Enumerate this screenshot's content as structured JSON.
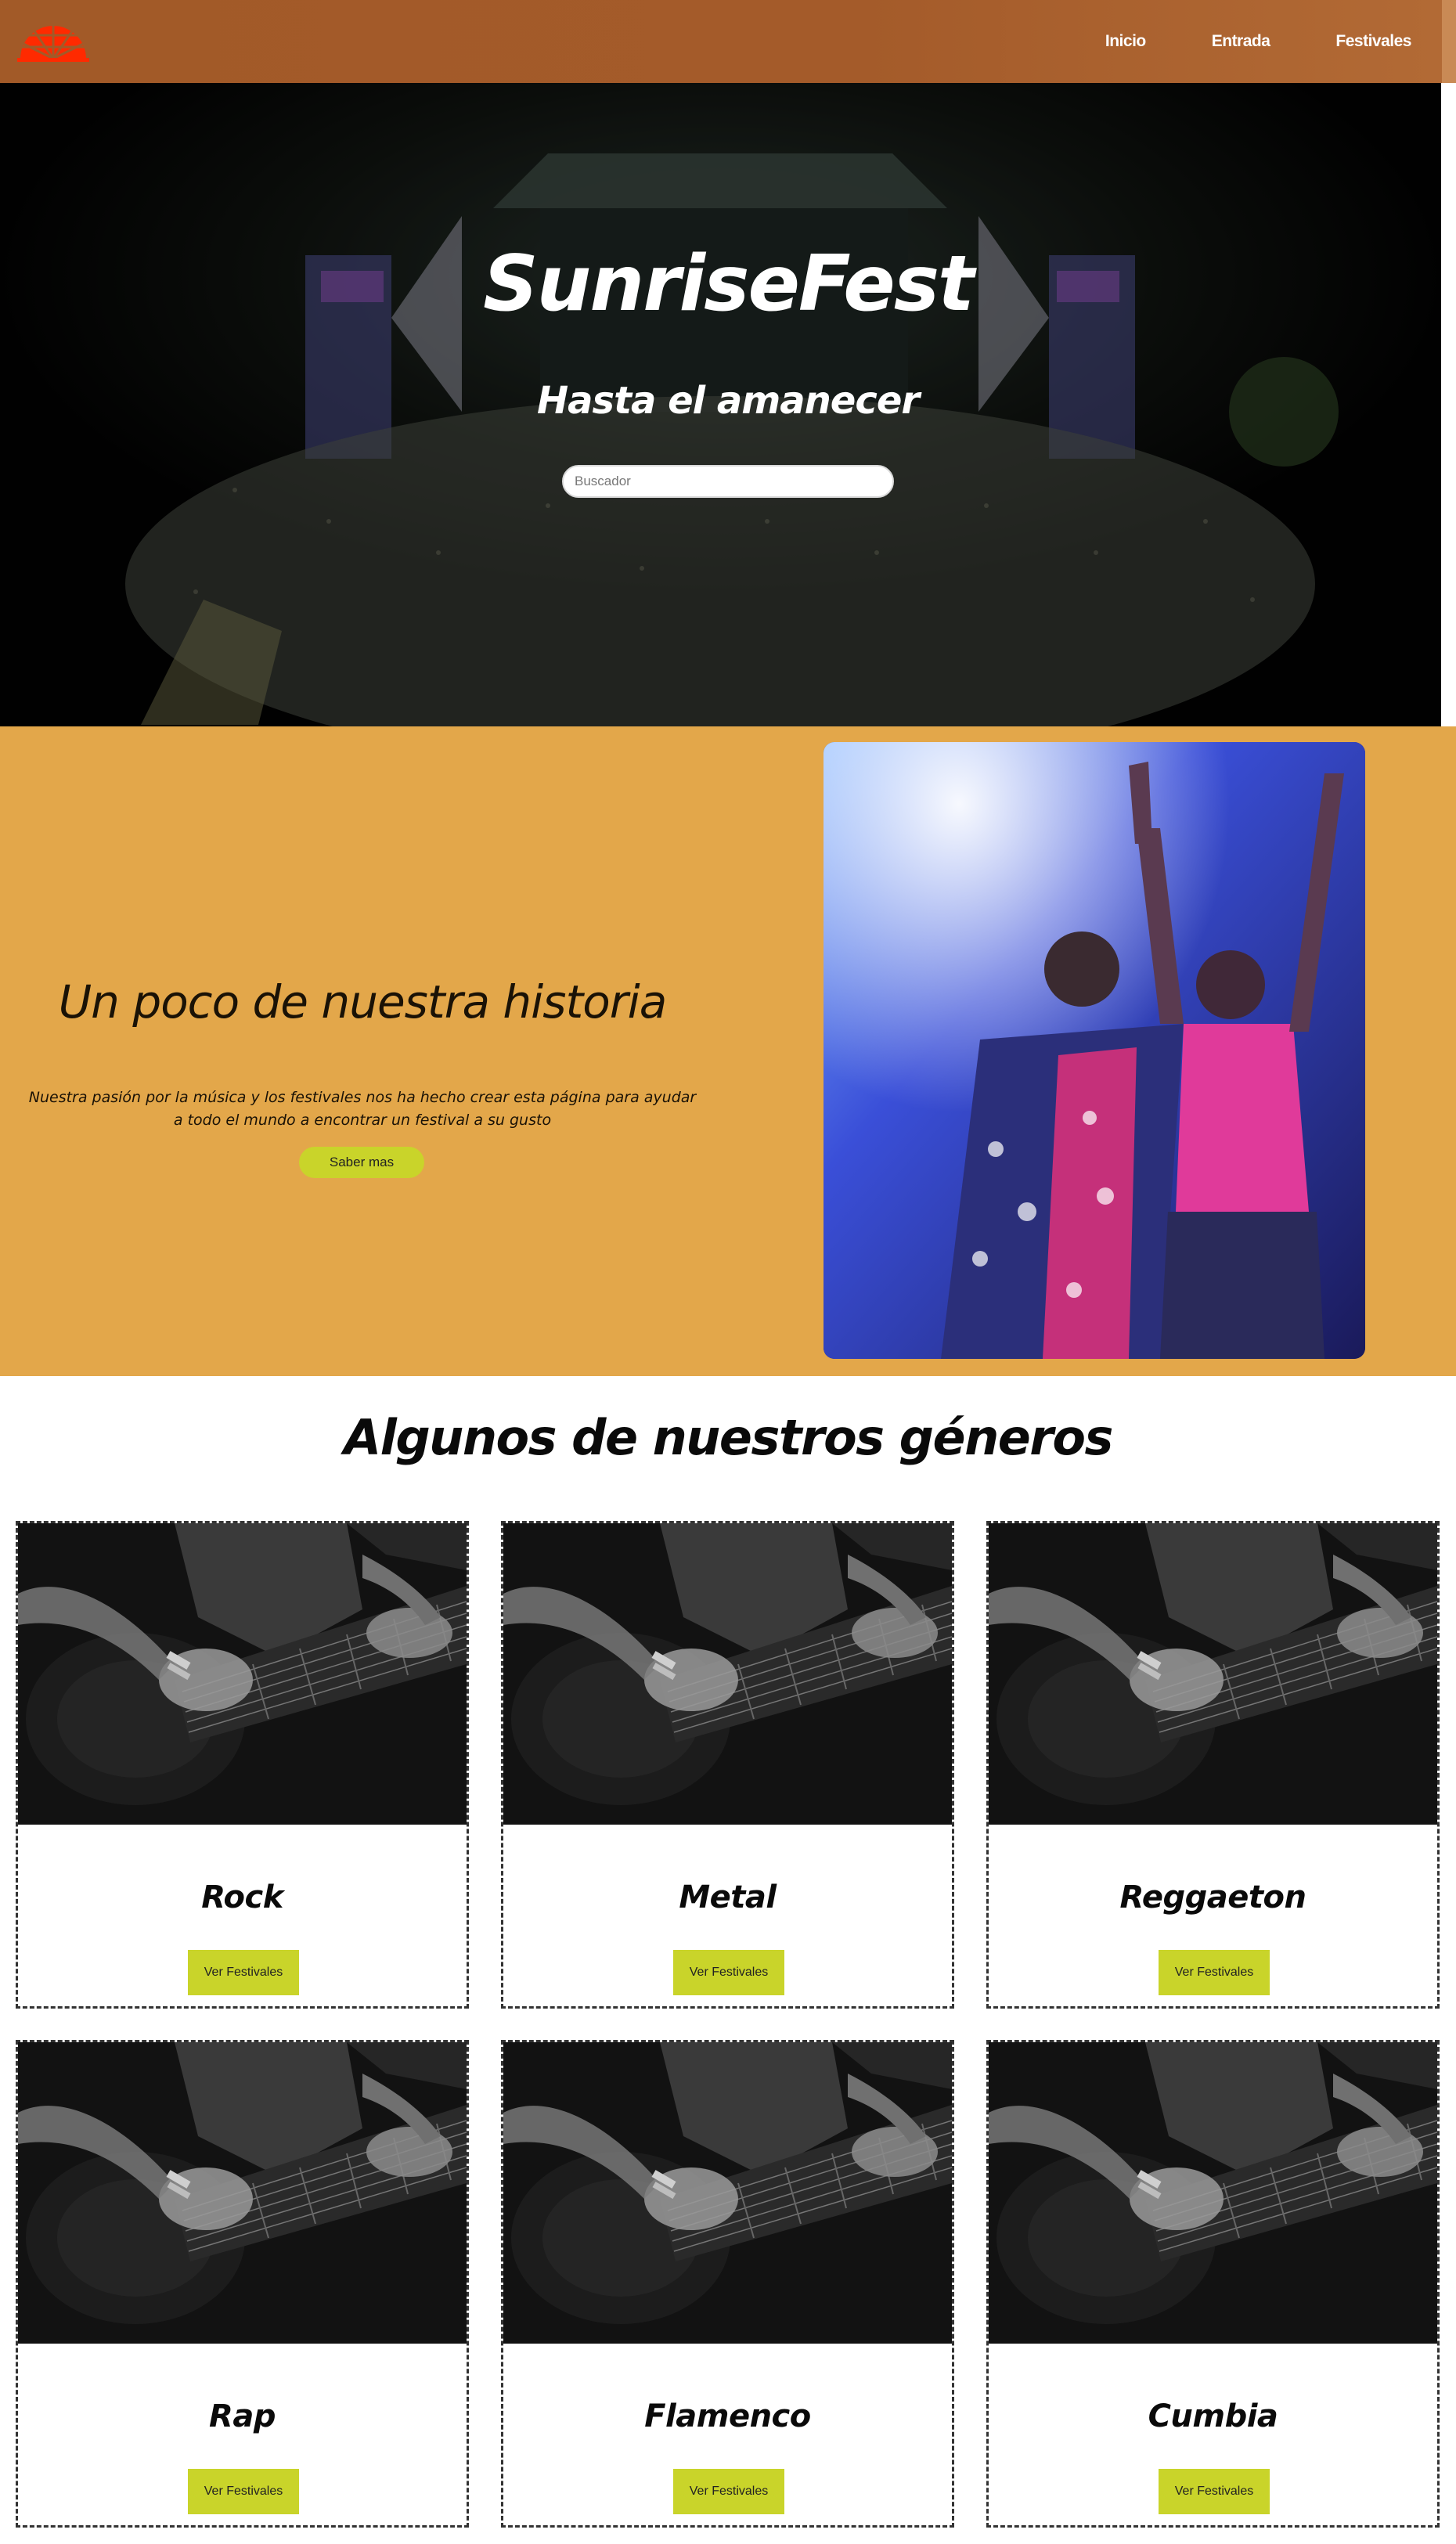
{
  "nav": {
    "logo": "sunrise-logo",
    "links": [
      {
        "label": "Inicio"
      },
      {
        "label": "Entrada"
      },
      {
        "label": "Festivales"
      }
    ]
  },
  "hero": {
    "title": "SunriseFest",
    "subtitle": "Hasta el amanecer",
    "search_placeholder": "Buscador"
  },
  "history": {
    "title": "Un poco de nuestra historia",
    "text": "Nuestra pasión por la música y los festivales nos ha hecho crear esta página para ayudar a todo el mundo a encontrar un festival a su gusto",
    "button": "Saber mas"
  },
  "genres": {
    "title": "Algunos de nuestros géneros",
    "cards": [
      {
        "name": "Rock",
        "button": "Ver Festivales"
      },
      {
        "name": "Metal",
        "button": "Ver Festivales"
      },
      {
        "name": "Reggaeton",
        "button": "Ver Festivales"
      },
      {
        "name": "Rap",
        "button": "Ver Festivales"
      },
      {
        "name": "Flamenco",
        "button": "Ver Festivales"
      },
      {
        "name": "Cumbia",
        "button": "Ver Festivales"
      }
    ]
  },
  "colors": {
    "nav_bg": "#a25a28",
    "history_bg": "#e3a74a",
    "accent_button": "#c9d42a",
    "logo_red": "#ff2a00"
  }
}
